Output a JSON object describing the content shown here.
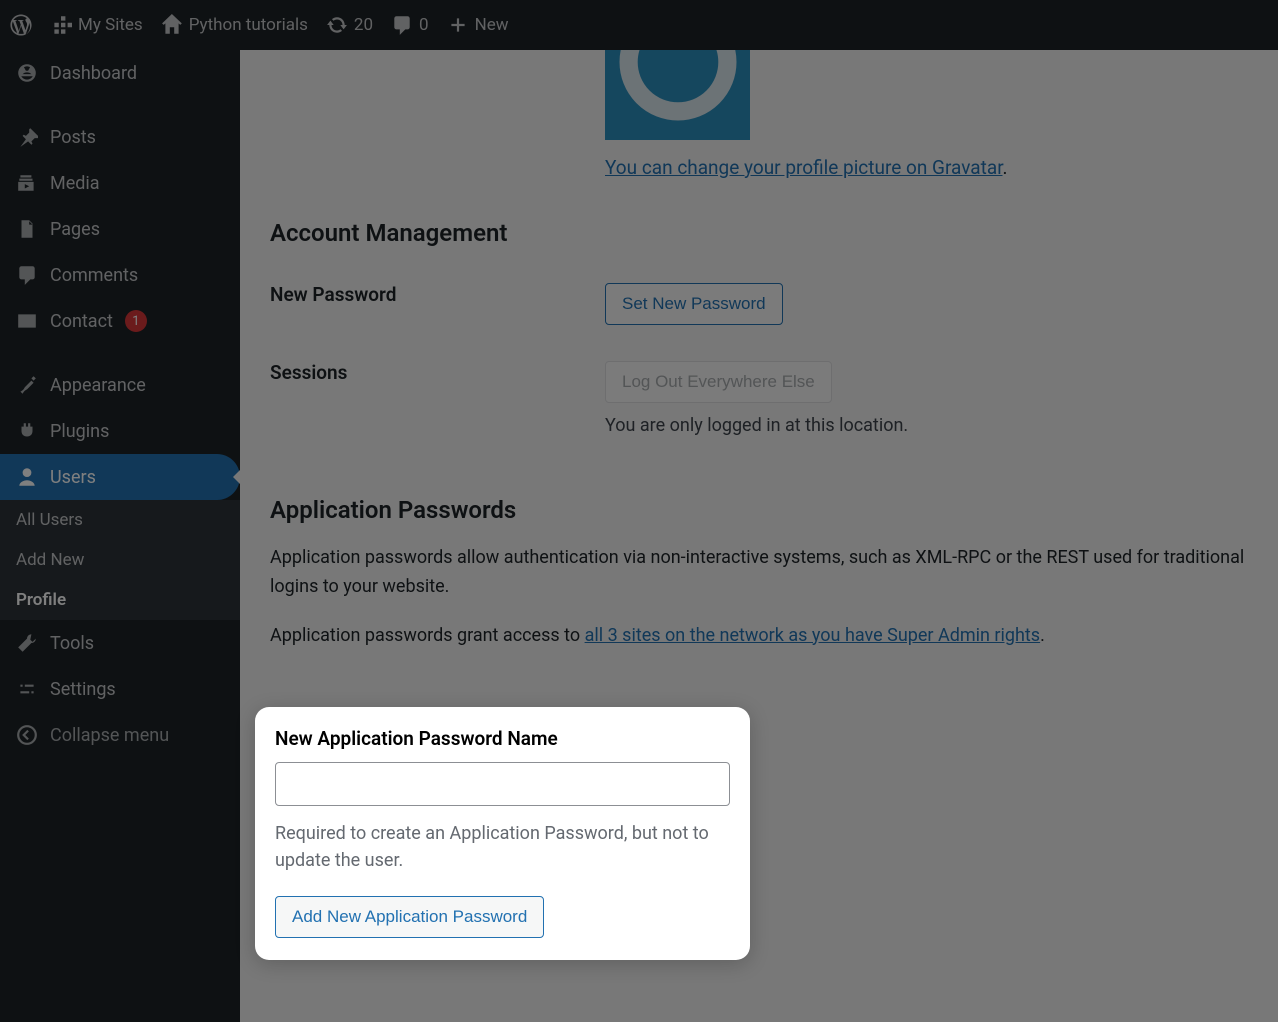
{
  "adminbar": {
    "my_sites": "My Sites",
    "site_title": "Python tutorials",
    "updates": "20",
    "comments": "0",
    "new": "New"
  },
  "sidebar": {
    "dashboard": "Dashboard",
    "posts": "Posts",
    "media": "Media",
    "pages": "Pages",
    "comments": "Comments",
    "contact": "Contact",
    "contact_badge": "1",
    "appearance": "Appearance",
    "plugins": "Plugins",
    "users": "Users",
    "users_sub": {
      "all": "All Users",
      "add": "Add New",
      "profile": "Profile"
    },
    "tools": "Tools",
    "settings": "Settings",
    "collapse": "Collapse menu"
  },
  "profile": {
    "gravatar_link": "You can change your profile picture on Gravatar",
    "section_account": "Account Management",
    "new_password_label": "New Password",
    "set_new_password_btn": "Set New Password",
    "sessions_label": "Sessions",
    "logout_btn": "Log Out Everywhere Else",
    "sessions_helper": "You are only logged in at this location.",
    "section_app_pw": "Application Passwords",
    "app_pw_desc1": "Application passwords allow authentication via non-interactive systems, such as XML-RPC or the REST used for traditional logins to your website.",
    "app_pw_desc2_pre": "Application passwords grant access to ",
    "app_pw_desc2_link": "all 3 sites on the network as you have Super Admin rights",
    "card_title": "New Application Password Name",
    "card_hint": "Required to create an Application Password, but not to update the user.",
    "card_button": "Add New Application Password"
  }
}
